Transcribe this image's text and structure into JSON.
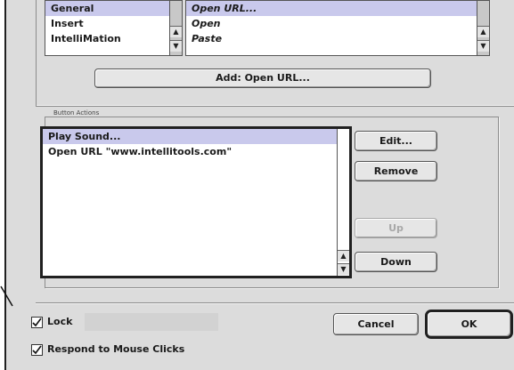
{
  "categories": {
    "items": [
      {
        "label": "General",
        "selected": true
      },
      {
        "label": "Insert",
        "selected": false
      },
      {
        "label": "IntelliMation",
        "selected": false
      }
    ]
  },
  "actions_available": {
    "items": [
      {
        "label": "Open URL...",
        "selected": true
      },
      {
        "label": "Open",
        "selected": false
      },
      {
        "label": "Paste",
        "selected": false
      }
    ]
  },
  "add_button": {
    "label": "Add:  Open URL..."
  },
  "button_actions": {
    "group_label": "Button Actions",
    "items": [
      {
        "label": "Play Sound...",
        "selected": true
      },
      {
        "label": "Open URL \"www.intellitools.com\"",
        "selected": false
      }
    ],
    "edit_label": "Edit...",
    "remove_label": "Remove",
    "up_label": "Up",
    "down_label": "Down"
  },
  "options": {
    "lock_label": "Lock",
    "lock_checked": true,
    "respond_label": "Respond to Mouse Clicks",
    "respond_checked": true
  },
  "dialog_buttons": {
    "cancel_label": "Cancel",
    "ok_label": "OK"
  },
  "colors": {
    "selection": "#c9c9ec",
    "dialog_bg": "#dcdcdc"
  }
}
